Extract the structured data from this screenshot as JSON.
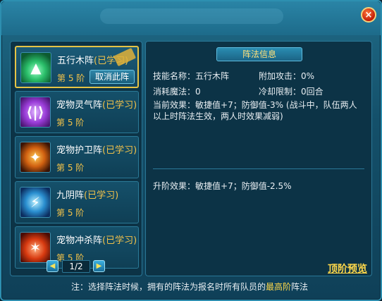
{
  "window": {
    "close_label": "×"
  },
  "list": {
    "items": [
      {
        "name": "五行木阵",
        "status": "(已学习)",
        "level": "第 5 阶",
        "icon": "wuxing-formation-icon",
        "selected": true,
        "cancel_label": "取消此阵"
      },
      {
        "name": "宠物灵气阵",
        "status": "(已学习)",
        "level": "第 5 阶",
        "icon": "pet-aura-formation-icon"
      },
      {
        "name": "宠物护卫阵",
        "status": "(已学习)",
        "level": "第 5 阶",
        "icon": "pet-guard-formation-icon"
      },
      {
        "name": "九阴阵",
        "status": "(已学习)",
        "level": "第 5 阶",
        "icon": "nine-yin-formation-icon"
      },
      {
        "name": "宠物冲杀阵",
        "status": "(已学习)",
        "level": "第 5 阶",
        "icon": "pet-charge-formation-icon"
      }
    ],
    "pager": {
      "prev": "◀",
      "page": "1/2",
      "next": "▶"
    }
  },
  "info": {
    "header": "阵法信息",
    "skill_name_label": "技能名称：",
    "skill_name": "五行木阵",
    "extra_attack_label": "附加攻击：",
    "extra_attack": "0%",
    "mana_cost_label": "消耗魔法：",
    "mana_cost": "0",
    "cooldown_label": "冷却限制：",
    "cooldown": "0回合",
    "current_effect_label": "当前效果：",
    "current_effect": "敏捷值+7；防御值-3% (战斗中，队伍两人以上时阵法生效，两人时效果减弱)",
    "upgrade_effect_label": "升阶效果：",
    "upgrade_effect": "敏捷值+7；防御值-2.5%",
    "preview_label": "顶阶预览"
  },
  "note": {
    "prefix": "注：选择阵法时候，拥有的阵法为报名时所有队员的",
    "highlight": "最高阶",
    "suffix": "阵法"
  }
}
